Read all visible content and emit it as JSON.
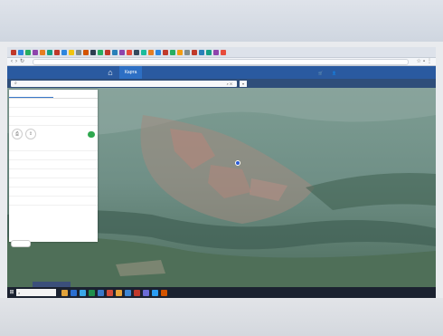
{
  "browser": {
    "url": "",
    "tab_icon_colors": [
      "#c0392b",
      "#2e86de",
      "#27ae60",
      "#8e44ad",
      "#e67e22",
      "#16a085",
      "#c0392b",
      "#2e86de",
      "#f1c40f",
      "#7f8c8d",
      "#d35400",
      "#2c3e50",
      "#27ae60",
      "#c0392b",
      "#2980b9",
      "#8e44ad",
      "#e74c3c",
      "#34495e",
      "#1abc9c",
      "#e67e22",
      "#2e86de",
      "#c0392b",
      "#27ae60",
      "#f39c12",
      "#7f8c8d",
      "#c0392b",
      "#2980b9",
      "#16a085",
      "#8e44ad",
      "#e74c3c"
    ]
  },
  "header": {
    "home_icon": "home-icon",
    "map_tab": "Карта",
    "cart_label": "",
    "login_label": "",
    "bg": "#2a5aa0",
    "active_tab_bg": "#2d6fc4"
  },
  "search": {
    "value": "",
    "icon": "search-icon"
  },
  "panel": {
    "tabs": [
      "",
      ""
    ],
    "rows_top": [
      {
        "k": "",
        "v": "",
        "link": true
      },
      {
        "k": "",
        "v": "",
        "link": false
      },
      {
        "k": "",
        "v": "",
        "link": false
      }
    ],
    "action_buttons": [
      "",
      ""
    ],
    "share_label": "",
    "primary_button": "",
    "rows_bottom": [
      {
        "k": "",
        "v": "",
        "link": false
      },
      {
        "k": "",
        "v": "",
        "link": true
      },
      {
        "k": "",
        "v": "",
        "link": false
      },
      {
        "k": "",
        "v": "",
        "link": false
      },
      {
        "k": "",
        "v": "",
        "link": false
      },
      {
        "k": "",
        "v": "",
        "link": false
      },
      {
        "k": "",
        "v": "",
        "link": false
      }
    ],
    "more_button": ""
  },
  "taskbar": {
    "search_placeholder": "",
    "toast": "",
    "tray_text": "",
    "time": "",
    "app_colors": [
      "#e1a23a",
      "#2b6fd1",
      "#3aa7e8",
      "#1e8f4c",
      "#3a78c9",
      "#d44c3a",
      "#e8a33a",
      "#3d86d4",
      "#c0392b",
      "#6b6bd6",
      "#2a9df4",
      "#d35400"
    ]
  }
}
